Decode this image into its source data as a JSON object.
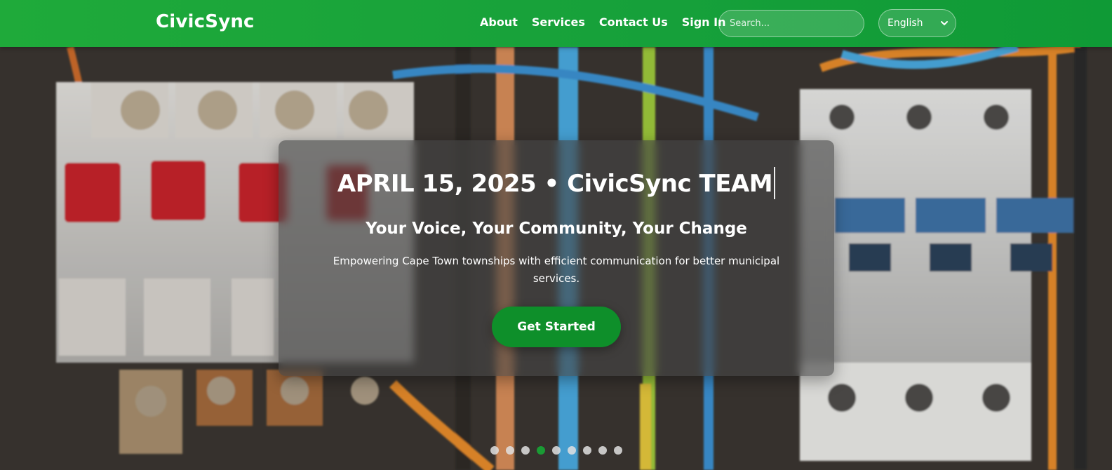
{
  "header": {
    "brand": "CivicSync",
    "nav": [
      {
        "label": "About"
      },
      {
        "label": "Services"
      },
      {
        "label": "Contact Us"
      },
      {
        "label": "Sign In"
      }
    ],
    "search": {
      "placeholder": "Search...",
      "value": ""
    },
    "language": {
      "selected": "English"
    }
  },
  "hero": {
    "headline": "APRIL 15, 2025 • CivicSync TEAM",
    "subtitle": "Your Voice, Your Community, Your Change",
    "description": "Empowering Cape Town townships with efficient communication for better municipal services.",
    "cta_label": "Get Started",
    "carousel": {
      "slide_count": 9,
      "active_index": 3
    }
  },
  "colors": {
    "brand_green": "#1faa3a",
    "cta_green": "#0e8f2a",
    "active_dot": "#1a9b34"
  }
}
